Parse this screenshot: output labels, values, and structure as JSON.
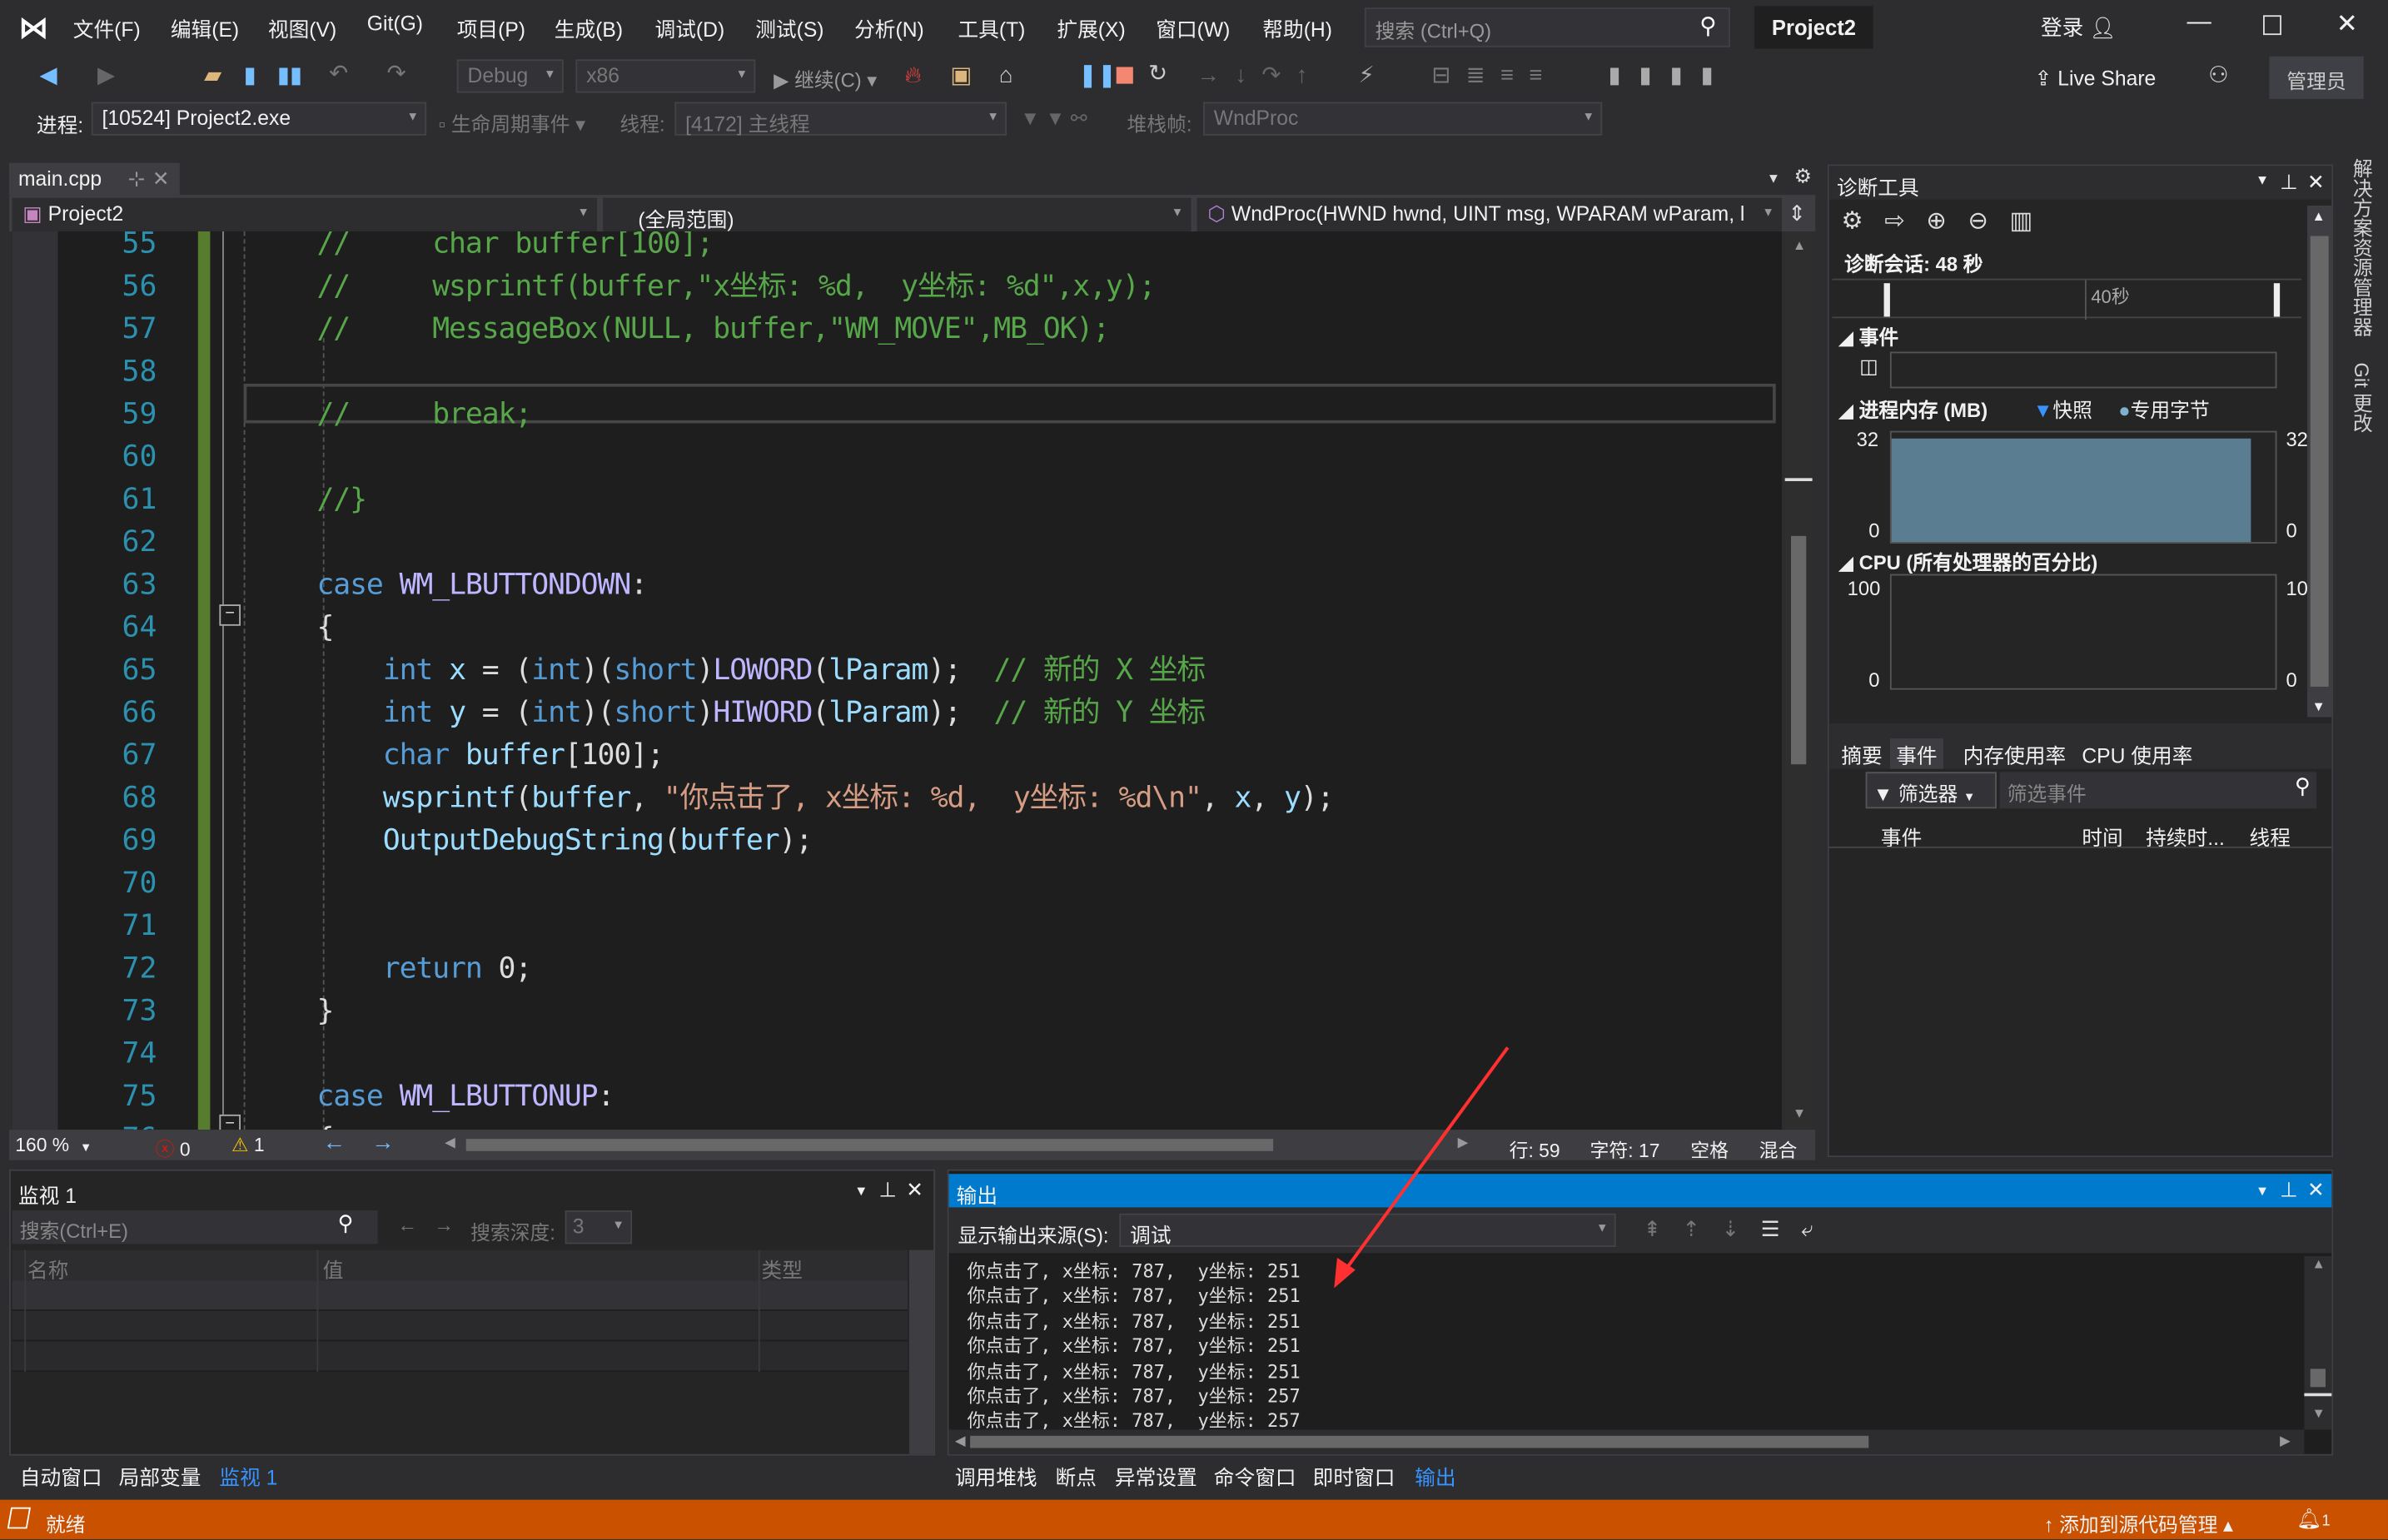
{
  "title_bar": {
    "menus": [
      "文件(F)",
      "编辑(E)",
      "视图(V)",
      "Git(G)",
      "项目(P)",
      "生成(B)",
      "调试(D)",
      "测试(S)",
      "分析(N)",
      "工具(T)",
      "扩展(X)",
      "窗口(W)",
      "帮助(H)"
    ],
    "search_placeholder": "搜索 (Ctrl+Q)",
    "solution_name": "Project2",
    "login": "登录"
  },
  "toolbar": {
    "config": "Debug",
    "platform": "x86",
    "continue": "继续(C)",
    "live_share": "Live Share",
    "admin": "管理员"
  },
  "debug_bar": {
    "process_label": "进程:",
    "process": "[10524] Project2.exe",
    "lifecycle": "生命周期事件",
    "thread_label": "线程:",
    "thread": "[4172] 主线程",
    "stack_label": "堆栈帧:",
    "stack": "WndProc"
  },
  "editor": {
    "tab": "main.cpp",
    "project": "Project2",
    "scope": "(全局范围)",
    "function": "WndProc(HWND hwnd, UINT msg, WPARAM wParam, l",
    "first_line": 55,
    "lines": [
      [
        [
          "comment",
          "//     char buffer[100];"
        ]
      ],
      [
        [
          "comment",
          "//     wsprintf(buffer,\"x坐标: %d,  y坐标: %d\",x,y);"
        ]
      ],
      [
        [
          "comment",
          "//     MessageBox(NULL, buffer,\"WM_MOVE\",MB_OK);"
        ]
      ],
      [],
      [
        [
          "comment",
          "//     break;"
        ]
      ],
      [],
      [
        [
          "comment",
          "//}"
        ]
      ],
      [],
      [
        [
          "keyword",
          "case "
        ],
        [
          "macro",
          "WM_LBUTTONDOWN"
        ],
        [
          "plain",
          ":"
        ]
      ],
      [
        [
          "plain",
          "{"
        ]
      ],
      [
        [
          "plain",
          "    "
        ],
        [
          "keyword",
          "int"
        ],
        [
          "var",
          " x "
        ],
        [
          "plain",
          "= ("
        ],
        [
          "keyword",
          "int"
        ],
        [
          "plain",
          ")("
        ],
        [
          "keyword",
          "short"
        ],
        [
          "plain",
          ")"
        ],
        [
          "macro",
          "LOWORD"
        ],
        [
          "plain",
          "("
        ],
        [
          "var",
          "lParam"
        ],
        [
          "plain",
          ");  "
        ],
        [
          "comment",
          "// 新的 X 坐标"
        ]
      ],
      [
        [
          "plain",
          "    "
        ],
        [
          "keyword",
          "int"
        ],
        [
          "var",
          " y "
        ],
        [
          "plain",
          "= ("
        ],
        [
          "keyword",
          "int"
        ],
        [
          "plain",
          ")("
        ],
        [
          "keyword",
          "short"
        ],
        [
          "plain",
          ")"
        ],
        [
          "macro",
          "HIWORD"
        ],
        [
          "plain",
          "("
        ],
        [
          "var",
          "lParam"
        ],
        [
          "plain",
          ");  "
        ],
        [
          "comment",
          "// 新的 Y 坐标"
        ]
      ],
      [
        [
          "plain",
          "    "
        ],
        [
          "keyword",
          "char"
        ],
        [
          "var",
          " buffer"
        ],
        [
          "plain",
          "[100];"
        ]
      ],
      [
        [
          "plain",
          "    "
        ],
        [
          "func",
          "wsprintf"
        ],
        [
          "plain",
          "("
        ],
        [
          "var",
          "buffer"
        ],
        [
          "plain",
          ", "
        ],
        [
          "string",
          "\"你点击了, x坐标: %d,  y坐标: %d\\n\""
        ],
        [
          "plain",
          ", "
        ],
        [
          "var",
          "x"
        ],
        [
          "plain",
          ", "
        ],
        [
          "var",
          "y"
        ],
        [
          "plain",
          ");"
        ]
      ],
      [
        [
          "plain",
          "    "
        ],
        [
          "func",
          "OutputDebugString"
        ],
        [
          "plain",
          "("
        ],
        [
          "var",
          "buffer"
        ],
        [
          "plain",
          ");"
        ]
      ],
      [],
      [],
      [
        [
          "plain",
          "    "
        ],
        [
          "keyword",
          "return"
        ],
        [
          "plain",
          " 0;"
        ]
      ],
      [
        [
          "plain",
          "}"
        ]
      ],
      [],
      [
        [
          "keyword",
          "case "
        ],
        [
          "macro",
          "WM_LBUTTONUP"
        ],
        [
          "plain",
          ":"
        ]
      ],
      [
        [
          "plain",
          "{"
        ]
      ]
    ]
  },
  "editor_status": {
    "zoom": "160 %",
    "errors": "0",
    "warnings": "1",
    "line": "行: 59",
    "char": "字符: 17",
    "spaces": "空格",
    "eol": "混合"
  },
  "diagnostics": {
    "title": "诊断工具",
    "session": "诊断会话: 48 秒",
    "timeline_tick": "40秒",
    "events": "事件",
    "memory": "进程内存 (MB)",
    "snapshot": "快照",
    "private_bytes": "专用字节",
    "mem_max": "32",
    "mem_min": "0",
    "cpu": "CPU (所有处理器的百分比)",
    "cpu_max": "100",
    "cpu_max_right": "10",
    "cpu_min": "0",
    "tabs": [
      "摘要",
      "事件",
      "内存使用率",
      "CPU 使用率"
    ],
    "filter": "筛选器",
    "filter_placeholder": "筛选事件",
    "columns": [
      "事件",
      "时间",
      "持续时...",
      "线程"
    ],
    "memory_fill_color": "#5a7d91"
  },
  "side_tabs": [
    "解决方案资源管理器",
    "Git 更改"
  ],
  "watch": {
    "title": "监视 1",
    "search_placeholder": "搜索(Ctrl+E)",
    "depth_label": "搜索深度:",
    "depth": "3",
    "columns": [
      "名称",
      "值",
      "类型"
    ],
    "tabs": [
      "自动窗口",
      "局部变量",
      "监视 1"
    ]
  },
  "output": {
    "title": "输出",
    "source_label": "显示输出来源(S):",
    "source": "调试",
    "lines": [
      "你点击了, x坐标: 787,  y坐标: 251",
      "你点击了, x坐标: 787,  y坐标: 251",
      "你点击了, x坐标: 787,  y坐标: 251",
      "你点击了, x坐标: 787,  y坐标: 251",
      "你点击了, x坐标: 787,  y坐标: 251",
      "你点击了, x坐标: 787,  y坐标: 257",
      "你点击了, x坐标: 787,  y坐标: 257"
    ],
    "tabs": [
      "调用堆栈",
      "断点",
      "异常设置",
      "命令窗口",
      "即时窗口",
      "输出"
    ]
  },
  "status_bar": {
    "ready": "就绪",
    "source_control": "添加到源代码管理",
    "notifications": "1",
    "color": "#ca5100"
  },
  "accent": "#007acc"
}
